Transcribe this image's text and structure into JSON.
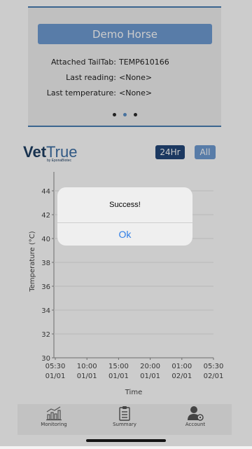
{
  "card": {
    "horse_name": "Demo Horse",
    "rows": [
      {
        "label": "Attached TailTab:",
        "value": "TEMP610166"
      },
      {
        "label": "Last reading:",
        "value": "<None>"
      },
      {
        "label": "Last temperature:",
        "value": "<None>"
      }
    ],
    "pager": {
      "count": 3,
      "active": 2
    }
  },
  "logo": {
    "vet": "Vet",
    "true": "True",
    "byline": "by EponaBiotec"
  },
  "range_buttons": {
    "h24": "24Hr",
    "all": "All"
  },
  "chart_data": {
    "type": "line",
    "ylabel": "Temperature (°C)",
    "xlabel": "Time",
    "ylim": [
      30,
      45
    ],
    "yticks": [
      30,
      32,
      34,
      36,
      38,
      40,
      42,
      44
    ],
    "xticks": [
      {
        "time": "05:30",
        "date": "01/01"
      },
      {
        "time": "10:00",
        "date": "01/01"
      },
      {
        "time": "15:00",
        "date": "01/01"
      },
      {
        "time": "20:00",
        "date": "01/01"
      },
      {
        "time": "01:00",
        "date": "02/01"
      },
      {
        "time": "05:30",
        "date": "02/01"
      }
    ],
    "series": [],
    "grid": true
  },
  "nav": {
    "items": [
      {
        "label": "Monitoring",
        "icon": "chart-icon"
      },
      {
        "label": "Summary",
        "icon": "clipboard-icon"
      },
      {
        "label": "Account",
        "icon": "user-settings-icon"
      }
    ]
  },
  "dialog": {
    "title": "Success!",
    "ok": "Ok"
  },
  "colors": {
    "accent": "#6f9bd2",
    "dark_accent": "#23487a",
    "link": "#2f7ee6"
  }
}
